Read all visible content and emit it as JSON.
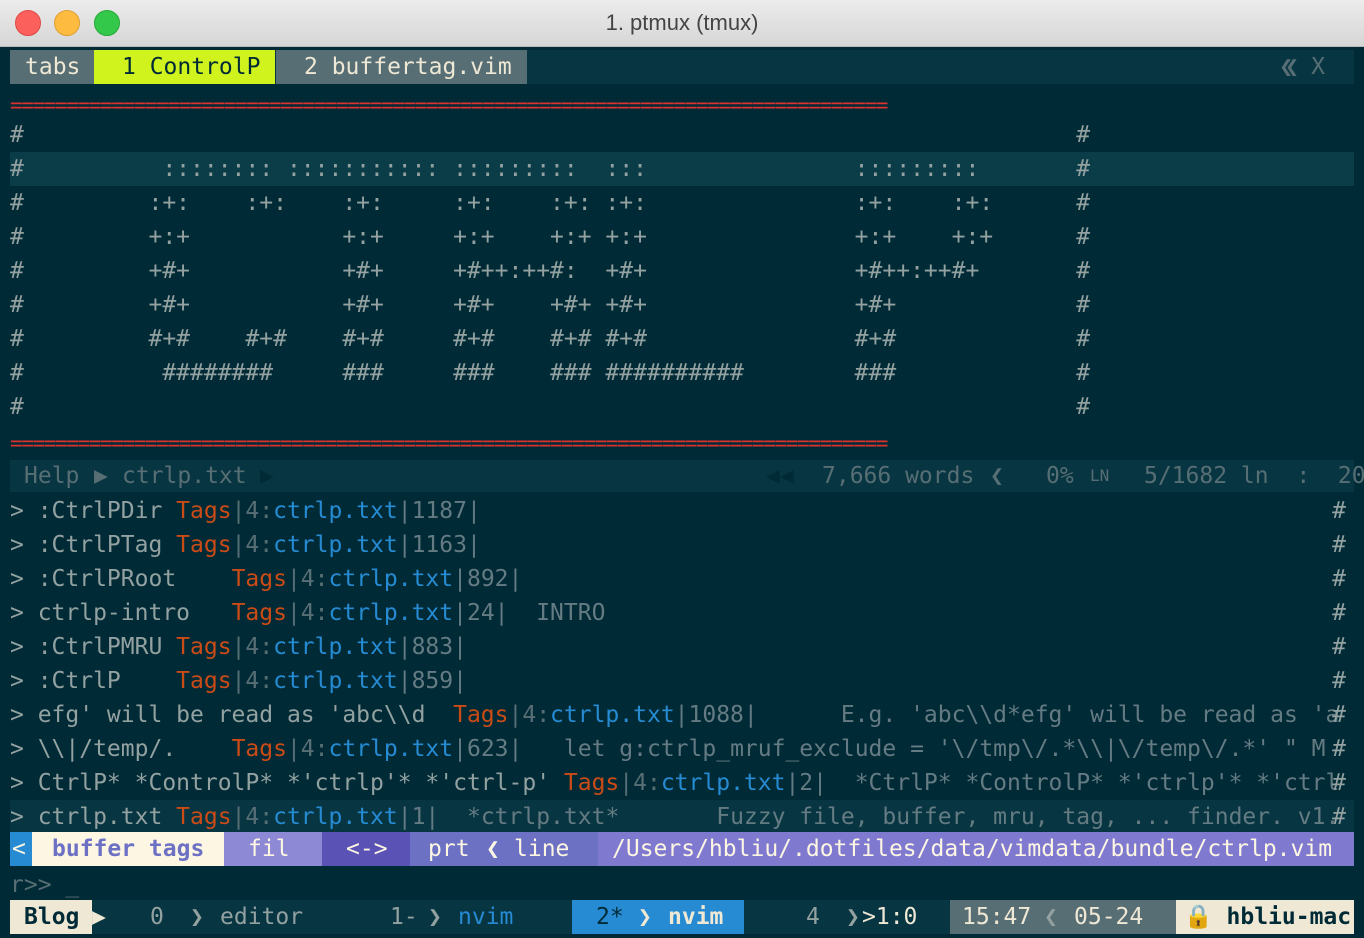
{
  "window": {
    "title": "1. ptmux (tmux)"
  },
  "tabline": {
    "label": "tabs",
    "tab1": "1 ControlP",
    "tab2": "2 buffertag.vim",
    "close": "X",
    "arrows": "❮❮"
  },
  "rule": "==============================================================================",
  "art": [
    "#                                                                            #",
    "#          :::::::: ::::::::::: :::::::::  :::               :::::::::       #",
    "#         :+:    :+:    :+:     :+:    :+: :+:               :+:    :+:      #",
    "#         +:+           +:+     +:+    +:+ +:+               +:+    +:+      #",
    "#         +#+           +#+     +#++:++#:  +#+               +#++:++#+       #",
    "#         +#+           +#+     +#+    +#+ +#+               +#+             #",
    "#         #+#    #+#    #+#     #+#    #+# #+#               #+#             #",
    "#          ########     ###     ###    ### ##########        ###             #",
    "#                                                                            #"
  ],
  "statusline": {
    "mode": "Help",
    "file": "ctrlp.txt",
    "words": "7,666 words",
    "percent": "0%",
    "position": "5/1682 ln  :  20"
  },
  "results": [
    {
      "prefix": "> :CtrlPDir ",
      "tag": "Tags",
      "pre": "|4:",
      "file": "ctrlp.txt",
      "rest": "|1187|"
    },
    {
      "prefix": "> :CtrlPTag ",
      "tag": "Tags",
      "pre": "|4:",
      "file": "ctrlp.txt",
      "rest": "|1163|"
    },
    {
      "prefix": "> :CtrlPRoot    ",
      "tag": "Tags",
      "pre": "|4:",
      "file": "ctrlp.txt",
      "rest": "|892|"
    },
    {
      "prefix": "> ctrlp-intro   ",
      "tag": "Tags",
      "pre": "|4:",
      "file": "ctrlp.txt",
      "rest": "|24|  INTRO"
    },
    {
      "prefix": "> :CtrlPMRU ",
      "tag": "Tags",
      "pre": "|4:",
      "file": "ctrlp.txt",
      "rest": "|883|"
    },
    {
      "prefix": "> :CtrlP    ",
      "tag": "Tags",
      "pre": "|4:",
      "file": "ctrlp.txt",
      "rest": "|859|"
    },
    {
      "prefix": "> efg' will be read as 'abc\\\\d  ",
      "tag": "Tags",
      "pre": "|4:",
      "file": "ctrlp.txt",
      "rest": "|1088|      E.g. 'abc\\\\d*efg' will be read as 'a"
    },
    {
      "prefix": "> \\\\|/temp/.    ",
      "tag": "Tags",
      "pre": "|4:",
      "file": "ctrlp.txt",
      "rest": "|623|   let g:ctrlp_mruf_exclude = '\\/tmp\\/.*\\\\|\\/temp\\/.*' \" M"
    },
    {
      "prefix": "> CtrlP* *ControlP* *'ctrlp'* *'ctrl-p' ",
      "tag": "Tags",
      "pre": "|4:",
      "file": "ctrlp.txt",
      "rest": "|2|  *CtrlP* *ControlP* *'ctrlp'* *'ctrl"
    },
    {
      "prefix": "> ctrlp.txt ",
      "tag": "Tags",
      "pre": "|4:",
      "file": "ctrlp.txt",
      "rest": "|1|  *ctrlp.txt*       Fuzzy file, buffer, mru, tag, ... finder. v1."
    }
  ],
  "result_hash": "#",
  "ctrlp": {
    "left": "<",
    "mode": "buffer tags",
    "next": "fil",
    "arrows": "<->",
    "prt": "prt",
    "line": "line",
    "path": "/Users/hbliu/.dotfiles/data/vimdata/bundle/ctrlp.vim"
  },
  "prompt": "r>> _",
  "tmux": {
    "session": "Blog",
    "w0": "0",
    "w0name": "editor",
    "w1": "1-",
    "w1name": "nvim",
    "w2": "2*",
    "w2name": "nvim",
    "w4": "4",
    "pane": ">1:0",
    "time": "15:47",
    "date": "05-24",
    "host": "hbliu-mac"
  },
  "colors": {
    "bg": "#002b36",
    "tag": "#cb4b16",
    "file": "#268bd2",
    "active_tab": "#d0f31d",
    "ctrlp": "#6c71c4",
    "tmux_active": "#268bd2"
  }
}
